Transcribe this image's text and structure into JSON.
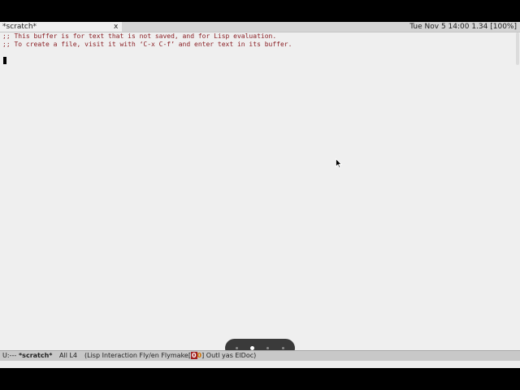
{
  "tab": {
    "label": "*scratch*",
    "close": "x"
  },
  "clock": "Tue Nov  5 14:00 1.34 [100%]",
  "buffer": {
    "lines": [
      ";; This buffer is for text that is not saved, and for Lisp evaluation.",
      ";; To create a file, visit it with ‘C-x C-f’ and enter text in its buffer."
    ]
  },
  "pager": {
    "count": 4,
    "active": 1
  },
  "modeline": {
    "state": "U:---",
    "buffer_name": "*scratch*",
    "position": "All L4",
    "modes_prefix": "(Lisp Interaction Fly/en Flymake[",
    "flymake_errors": "0",
    "flymake_warnings": "0",
    "modes_suffix": "] Outl yas ElDoc)"
  },
  "colors": {
    "comment": "#8a1f24",
    "background": "#efefef",
    "modeline": "#c8c8c8"
  }
}
